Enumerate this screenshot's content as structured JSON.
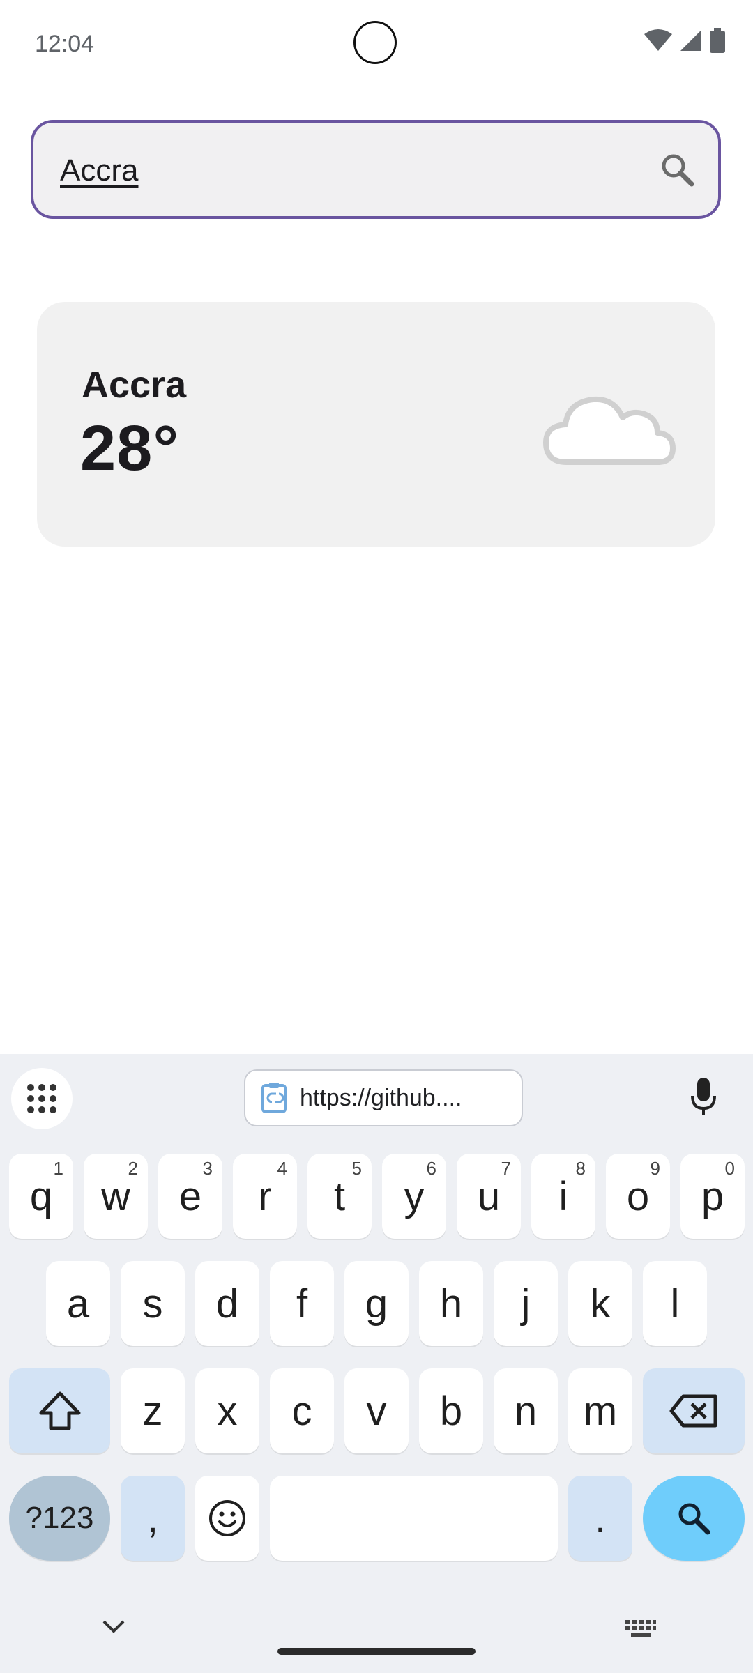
{
  "status_bar": {
    "time": "12:04"
  },
  "search": {
    "value": "Accra"
  },
  "weather_card": {
    "city": "Accra",
    "temperature": "28°",
    "condition_icon": "night-cloudy-icon"
  },
  "keyboard": {
    "clipboard_chip": "https://github....",
    "row1": [
      {
        "label": "q",
        "hint": "1"
      },
      {
        "label": "w",
        "hint": "2"
      },
      {
        "label": "e",
        "hint": "3"
      },
      {
        "label": "r",
        "hint": "4"
      },
      {
        "label": "t",
        "hint": "5"
      },
      {
        "label": "y",
        "hint": "6"
      },
      {
        "label": "u",
        "hint": "7"
      },
      {
        "label": "i",
        "hint": "8"
      },
      {
        "label": "o",
        "hint": "9"
      },
      {
        "label": "p",
        "hint": "0"
      }
    ],
    "row2": [
      "a",
      "s",
      "d",
      "f",
      "g",
      "h",
      "j",
      "k",
      "l"
    ],
    "row3": [
      "z",
      "x",
      "c",
      "v",
      "b",
      "n",
      "m"
    ],
    "symbols_label": "?123",
    "comma": ",",
    "period": "."
  },
  "colors": {
    "search_border": "#6a55a0",
    "moon": "#1a73e8",
    "search_key": "#6fcdfb"
  }
}
